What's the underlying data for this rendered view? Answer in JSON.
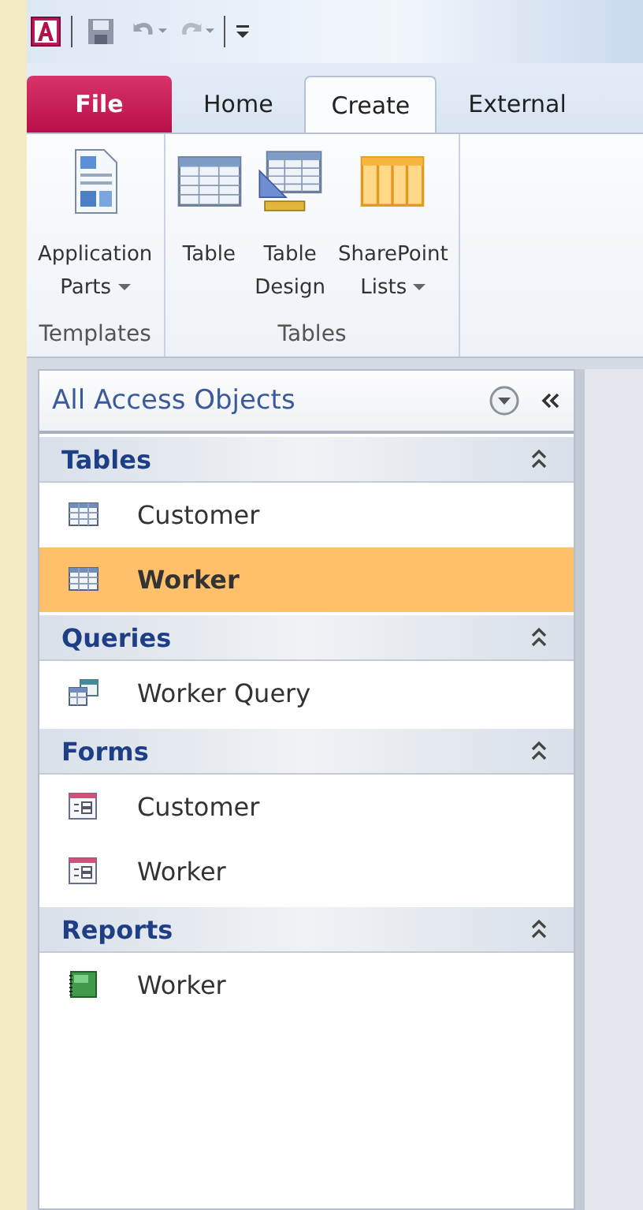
{
  "tabs": [
    {
      "label": "File",
      "kind": "file",
      "selected": false
    },
    {
      "label": "Home",
      "kind": "tab",
      "selected": false
    },
    {
      "label": "Create",
      "kind": "tab",
      "selected": true
    },
    {
      "label": "External",
      "kind": "tab",
      "selected": false
    }
  ],
  "ribbon_groups": [
    {
      "label": "Templates",
      "buttons": [
        {
          "lines": [
            "Application",
            "Parts"
          ],
          "dropdown": true,
          "kind": "app-parts"
        }
      ]
    },
    {
      "label": "Tables",
      "buttons": [
        {
          "lines": [
            "Table"
          ],
          "dropdown": false,
          "kind": "table"
        },
        {
          "lines": [
            "Table",
            "Design"
          ],
          "dropdown": false,
          "kind": "table-design"
        },
        {
          "lines": [
            "SharePoint",
            "Lists"
          ],
          "dropdown": true,
          "kind": "sharepoint"
        }
      ]
    }
  ],
  "nav_pane": {
    "title": "All Access Objects",
    "sections": [
      {
        "label": "Tables",
        "expanded": true,
        "items": [
          {
            "label": "Customer",
            "kind": "table",
            "selected": false
          },
          {
            "label": "Worker",
            "kind": "table",
            "selected": true
          }
        ]
      },
      {
        "label": "Queries",
        "expanded": true,
        "items": [
          {
            "label": "Worker Query",
            "kind": "query",
            "selected": false
          }
        ]
      },
      {
        "label": "Forms",
        "expanded": true,
        "items": [
          {
            "label": "Customer",
            "kind": "form",
            "selected": false
          },
          {
            "label": "Worker",
            "kind": "form",
            "selected": false
          }
        ]
      },
      {
        "label": "Reports",
        "expanded": true,
        "items": [
          {
            "label": "Worker",
            "kind": "report",
            "selected": false
          }
        ]
      }
    ]
  }
}
